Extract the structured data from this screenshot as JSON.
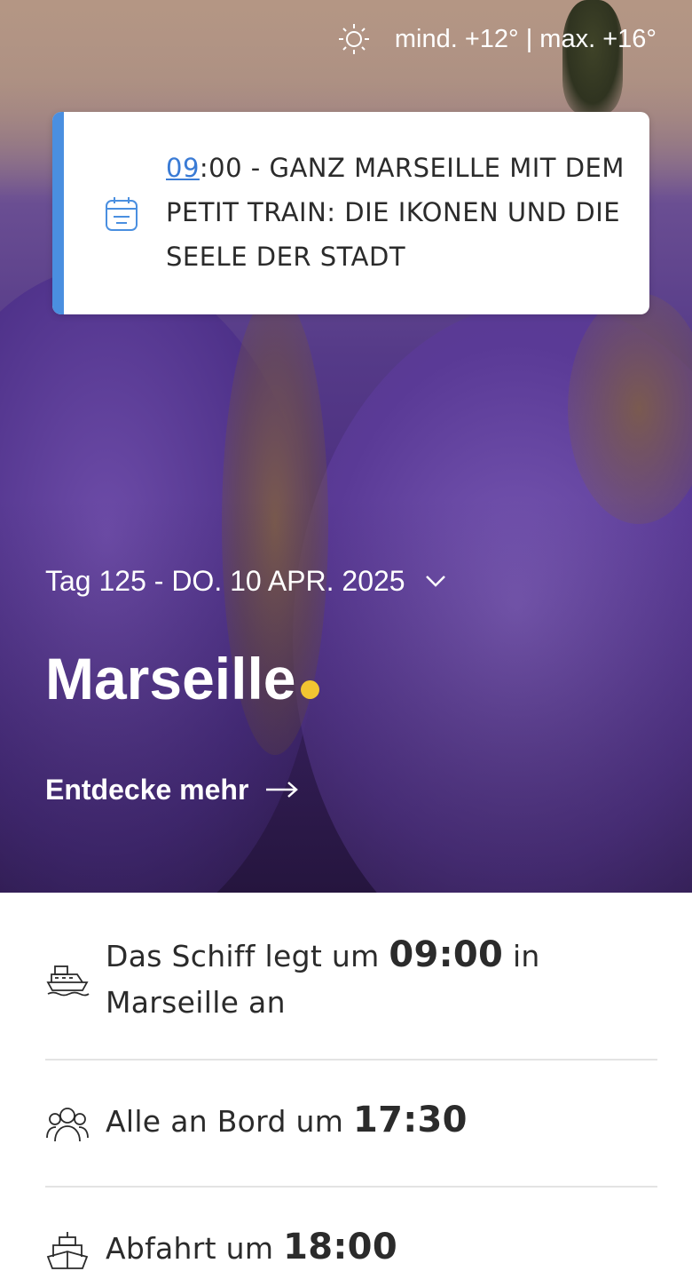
{
  "weather": {
    "icon": "sun-icon",
    "text": "mind. +12° | max. +16°"
  },
  "event": {
    "icon": "calendar-icon",
    "accent_color": "#4a8fe0",
    "hour": "09",
    "rest": ":00 - GANZ MARSEILLE MIT DEM PETIT TRAIN: DIE IKONEN UND DIE SEELE DER STADT"
  },
  "day": {
    "label": "Tag 125 - DO. 10 APR. 2025",
    "icon": "chevron-down-icon"
  },
  "city": {
    "name": "Marseille",
    "dot_color": "#f2c531"
  },
  "discover": {
    "label": "Entdecke mehr",
    "icon": "arrow-right-icon"
  },
  "info": {
    "arrival": {
      "icon": "ship-icon",
      "prefix": "Das Schiff legt um ",
      "time": "09:00",
      "suffix": " in Marseille an"
    },
    "all_aboard": {
      "icon": "group-icon",
      "prefix": "Alle an Bord um ",
      "time": "17:30"
    },
    "departure": {
      "icon": "ship-departure-icon",
      "prefix": "Abfahrt um ",
      "time": "18:00"
    }
  }
}
